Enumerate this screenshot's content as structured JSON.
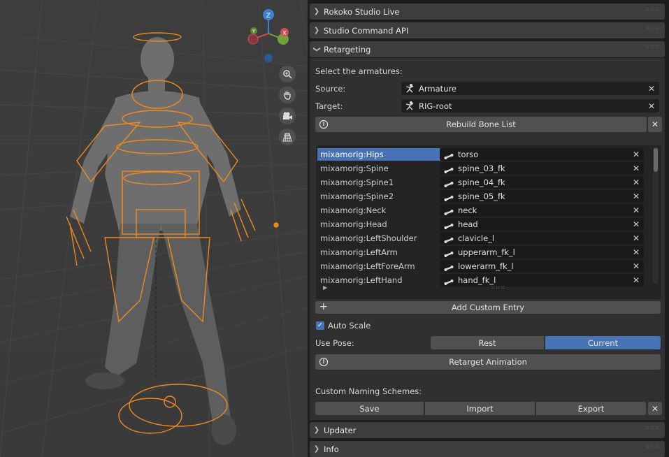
{
  "panels": {
    "rokoko_studio_live": "Rokoko Studio Live",
    "studio_command_api": "Studio Command API",
    "retargeting": "Retargeting",
    "updater": "Updater",
    "info": "Info"
  },
  "retargeting": {
    "select_label": "Select the armatures:",
    "source_label": "Source:",
    "source_value": "Armature",
    "target_label": "Target:",
    "target_value": "RIG-root",
    "rebuild_button": "Rebuild Bone List",
    "bone_rows": [
      {
        "source": "mixamorig:Hips",
        "target": "torso"
      },
      {
        "source": "mixamorig:Spine",
        "target": "spine_03_fk"
      },
      {
        "source": "mixamorig:Spine1",
        "target": "spine_04_fk"
      },
      {
        "source": "mixamorig:Spine2",
        "target": "spine_05_fk"
      },
      {
        "source": "mixamorig:Neck",
        "target": "neck"
      },
      {
        "source": "mixamorig:Head",
        "target": "head"
      },
      {
        "source": "mixamorig:LeftShoulder",
        "target": "clavicle_l"
      },
      {
        "source": "mixamorig:LeftArm",
        "target": "upperarm_fk_l"
      },
      {
        "source": "mixamorig:LeftForeArm",
        "target": "lowerarm_fk_l"
      },
      {
        "source": "mixamorig:LeftHand",
        "target": "hand_fk_l"
      }
    ],
    "add_custom_entry": "Add Custom Entry",
    "auto_scale_label": "Auto Scale",
    "auto_scale_checked": true,
    "use_pose_label": "Use Pose:",
    "pose_options": [
      "Rest",
      "Current"
    ],
    "pose_selected": "Current",
    "retarget_button": "Retarget Animation",
    "custom_naming_label": "Custom Naming Schemes:",
    "naming_buttons": {
      "save": "Save",
      "import": "Import",
      "export": "Export"
    }
  },
  "gizmo": {
    "z": "Z",
    "x": "X",
    "y": "Y"
  },
  "colors": {
    "accent": "#4772b3",
    "armature": "#f08a1e",
    "panel": "#303030"
  }
}
